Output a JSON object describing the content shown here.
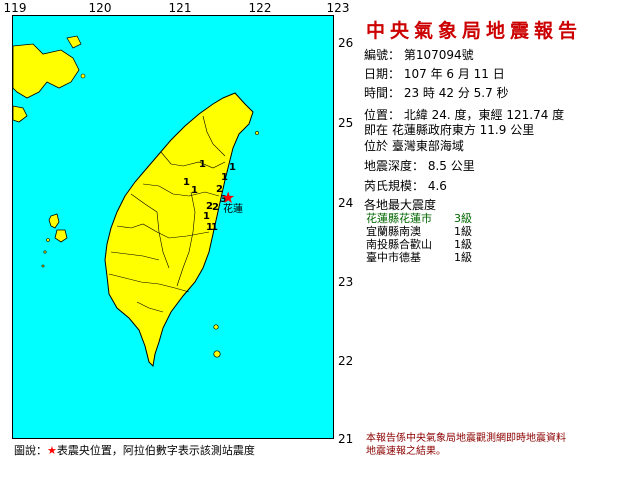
{
  "report": {
    "title": "中央氣象局地震報告",
    "number_label": "編號：",
    "number": "第107094號",
    "date_label": "日期：",
    "date": "107 年 6 月 11 日",
    "time_label": "時間：",
    "time": "23 時 42 分 5.7 秒",
    "position_label": "位置：",
    "position": "北緯 24. 度，東經 121.74 度",
    "relative_label": "即在",
    "relative": "花蓮縣政府東方 11.9 公里",
    "area_label": "位於",
    "area": "臺灣東部海域",
    "depth_label": "地震深度：",
    "depth": "8.5 公里",
    "magnitude_label": "芮氏規模：",
    "magnitude": "4.6",
    "max_intensity_label": "各地最大震度"
  },
  "max_intensity": [
    {
      "location": "花蓮縣花蓮市",
      "level": "3級"
    },
    {
      "location": "宜蘭縣南澳",
      "level": "1級"
    },
    {
      "location": "南投縣合歡山",
      "level": "1級"
    },
    {
      "location": "臺中市德基",
      "level": "1級"
    }
  ],
  "map": {
    "lon_ticks": [
      "119",
      "120",
      "121",
      "122",
      "123"
    ],
    "lat_ticks": [
      "26",
      "25",
      "24",
      "23",
      "22",
      "21"
    ],
    "epicenter_label": "花蓮",
    "sea_color": "#00ffff",
    "land_color": "#ffff00",
    "epicenter_color": "#ff0000",
    "intensity_labels": [
      "1",
      "1",
      "1",
      "1",
      "1",
      "2",
      "3",
      "2",
      "2",
      "1",
      "1",
      "1"
    ]
  },
  "legend": {
    "prefix": "圖說：",
    "star": "★",
    "text": "表震央位置，阿拉伯數字表示該測站震度"
  },
  "footnote": {
    "line1": "本報告係中央氣象局地震觀測網即時地震資料",
    "line2": "地震速報之結果。"
  }
}
